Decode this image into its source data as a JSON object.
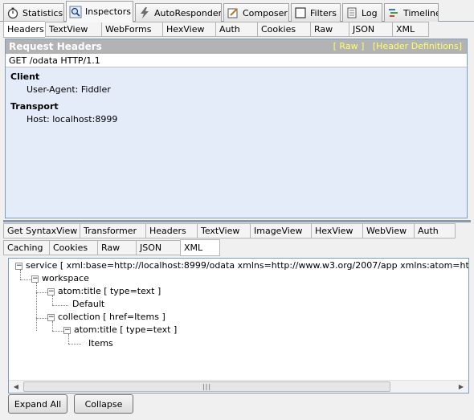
{
  "top_tabs": [
    {
      "label": "Statistics",
      "icon": "stopwatch-icon"
    },
    {
      "label": "Inspectors",
      "icon": "magnifier-icon",
      "active": true
    },
    {
      "label": "AutoResponder",
      "icon": "lightning-icon"
    },
    {
      "label": "Composer",
      "icon": "pencil-icon"
    },
    {
      "label": "Filters",
      "icon": "checkbox-icon"
    },
    {
      "label": "Log",
      "icon": "document-icon"
    },
    {
      "label": "Timeline",
      "icon": "timeline-icon"
    }
  ],
  "request_tabs": [
    "Headers",
    "TextView",
    "WebForms",
    "HexView",
    "Auth",
    "Cookies",
    "Raw",
    "JSON",
    "XML"
  ],
  "request": {
    "title": "Request Headers",
    "raw_link": "[ Raw ]",
    "defs_link": "[Header Definitions]",
    "request_line": "GET /odata HTTP/1.1",
    "groups": [
      {
        "name": "Client",
        "headers": [
          "User-Agent: Fiddler"
        ]
      },
      {
        "name": "Transport",
        "headers": [
          "Host: localhost:8999"
        ]
      }
    ]
  },
  "response_tabs_row1": [
    "Get SyntaxView",
    "Transformer",
    "Headers",
    "TextView",
    "ImageView",
    "HexView",
    "WebView",
    "Auth"
  ],
  "response_tabs_row2": [
    "Caching",
    "Cookies",
    "Raw",
    "JSON",
    "XML"
  ],
  "xml_tree": {
    "service": "service [ xml:base=http://localhost:8999/odata xmlns=http://www.w3.org/2007/app xmlns:atom=http://www.",
    "workspace": "workspace",
    "atom_title_1": "atom:title [ type=text ]",
    "default": "Default",
    "collection": "collection [ href=Items ]",
    "atom_title_2": "atom:title [ type=text ]",
    "items": "Items"
  },
  "buttons": {
    "expand_all": "Expand All",
    "collapse": "Collapse"
  }
}
